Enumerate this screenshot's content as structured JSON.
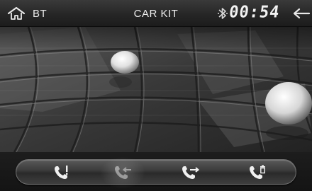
{
  "header": {
    "home_icon": "home-icon",
    "bt_label": "BT",
    "title": "CAR KIT",
    "bluetooth_icon": "bluetooth-icon",
    "clock": "00:54",
    "back_icon": "back-arrow-icon"
  },
  "call_bar": {
    "buttons": [
      {
        "name": "missed-calls-button",
        "icon": "phone-missed-icon"
      },
      {
        "name": "received-calls-button",
        "icon": "phone-incoming-icon",
        "state": "selected"
      },
      {
        "name": "dialed-calls-button",
        "icon": "phone-outgoing-icon"
      },
      {
        "name": "delete-call-log-button",
        "icon": "phone-delete-icon"
      }
    ]
  },
  "colors": {
    "bar_bg": "#2a2a2a",
    "text": "#e6e6e6",
    "icon": "#f0f0f0"
  }
}
